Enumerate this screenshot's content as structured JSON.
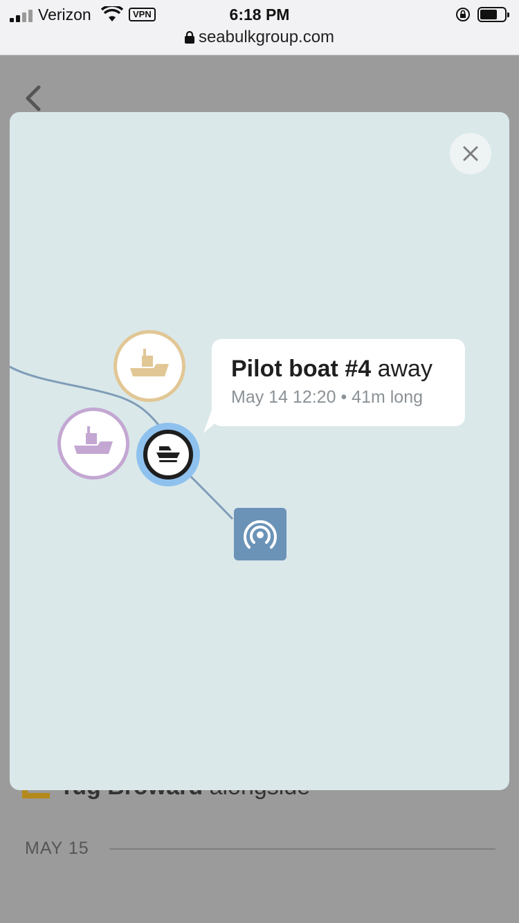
{
  "status_bar": {
    "carrier": "Verizon",
    "vpn": "VPN",
    "time": "6:18 PM",
    "url": "seabulkgroup.com"
  },
  "background_page": {
    "event_name": "Tug Broward",
    "event_status": "alongside",
    "date_divider": "MAY 15"
  },
  "tooltip": {
    "vessel_name": "Pilot boat #4",
    "status": "away",
    "date": "May 14 12:20",
    "separator": "•",
    "duration": "41m long"
  },
  "colors": {
    "modal_bg": "#dae8ea",
    "tan_vessel": "#e1c795",
    "purple_vessel": "#c3a7d2",
    "active_halo": "#8ec1ee",
    "station": "#6b93b8",
    "route": "#7f9cb7"
  }
}
